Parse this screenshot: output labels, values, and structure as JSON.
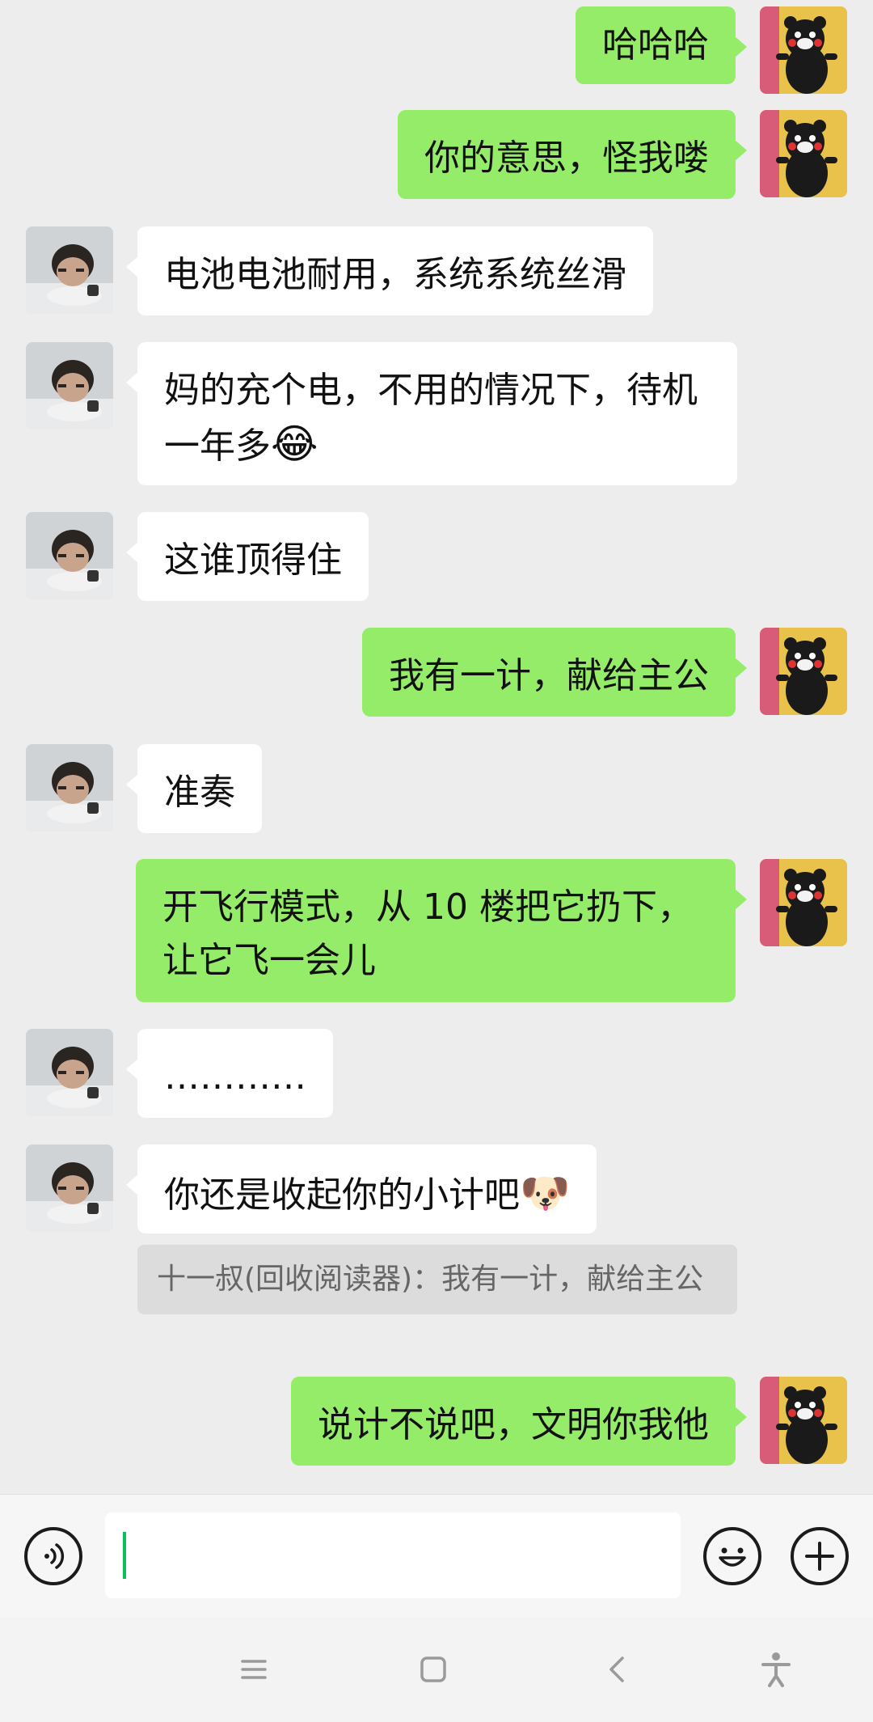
{
  "messages": [
    {
      "side": "right",
      "text": "哈哈哈"
    },
    {
      "side": "right",
      "text": "你的意思，怪我喽"
    },
    {
      "side": "left",
      "text": "电池电池耐用，系统系统丝滑"
    },
    {
      "side": "left",
      "text": "妈的充个电，不用的情况下，待机一年多",
      "emoji": "😂"
    },
    {
      "side": "left",
      "text": "这谁顶得住"
    },
    {
      "side": "right",
      "text": "我有一计，献给主公"
    },
    {
      "side": "left",
      "text": "准奏"
    },
    {
      "side": "right",
      "text": "开飞行模式，从 10 楼把它扔下，让它飞一会儿"
    },
    {
      "side": "left",
      "text": "…………"
    },
    {
      "side": "left",
      "text": "你还是收起你的小计吧",
      "emoji": "🐶"
    },
    {
      "side": "right",
      "text": "说计不说吧，文明你我他"
    }
  ],
  "quote": {
    "text": "十一叔(回收阅读器)：我有一计，献给主公"
  },
  "input_bar": {
    "voice_icon": "voice-icon",
    "emoji_icon": "emoji-icon",
    "plus_icon": "plus-icon",
    "text": ""
  },
  "navbar": {
    "icons": [
      "menu-icon",
      "home-icon",
      "back-icon",
      "accessibility-icon"
    ]
  },
  "colors": {
    "background": "#ededed",
    "outgoing_bubble": "#95ec69",
    "incoming_bubble": "#ffffff",
    "caret": "#07c160"
  }
}
